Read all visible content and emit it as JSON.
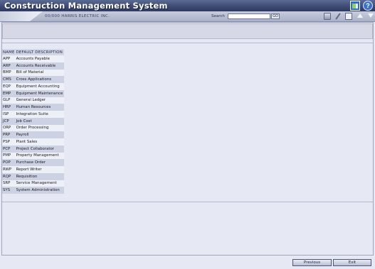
{
  "app": {
    "title": "Construction Management System"
  },
  "toolbar": {
    "company": "00/000  HARRIS ELECTRIC INC.",
    "search_label": "Search",
    "search_value": "",
    "search_go": "GO"
  },
  "table": {
    "headers": [
      "NAME",
      "DEFAULT DESCRIPTION"
    ],
    "rows": [
      [
        "APP",
        "Accounts Payable"
      ],
      [
        "ARP",
        "Accounts Receivable"
      ],
      [
        "BMP",
        "Bill of Material"
      ],
      [
        "CMS",
        "Cross Applications"
      ],
      [
        "EQP",
        "Equipment Accounting"
      ],
      [
        "EMP",
        "Equipment Maintenance"
      ],
      [
        "GLP",
        "General Ledger"
      ],
      [
        "HRP",
        "Human Resources"
      ],
      [
        "ISP",
        "Integration Suite"
      ],
      [
        "JCP",
        "Job Cost"
      ],
      [
        "ORP",
        "Order Processing"
      ],
      [
        "PRP",
        "Payroll"
      ],
      [
        "PSP",
        "Plant Sales"
      ],
      [
        "PCP",
        "Project Collaborator"
      ],
      [
        "PMP",
        "Property Management"
      ],
      [
        "POP",
        "Purchase Order"
      ],
      [
        "RWP",
        "Report Writer"
      ],
      [
        "RQP",
        "Requisition"
      ],
      [
        "SRP",
        "Service Management"
      ],
      [
        "SYS",
        "System Administration"
      ]
    ]
  },
  "footer": {
    "previous_label": "Previous",
    "exit_label": "Exit"
  },
  "icons": [
    "window-icon",
    "help-icon",
    "print-icon",
    "edit-icon",
    "copy-icon",
    "up-arrow-icon",
    "down-arrow-icon"
  ],
  "colors": {
    "titlebar": "#3e4b75",
    "background": "#e6e8f4",
    "row_stripe": "#cdd1e4"
  }
}
